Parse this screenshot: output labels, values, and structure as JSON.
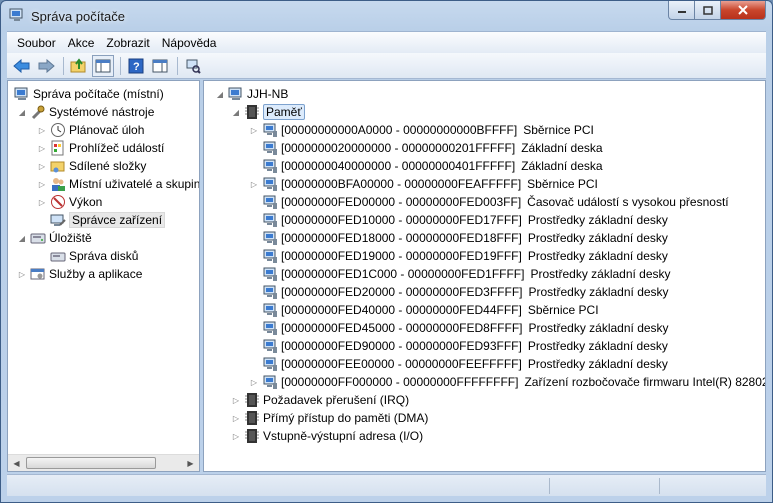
{
  "window": {
    "title": "Správa počítače"
  },
  "menu": [
    {
      "label": "Soubor"
    },
    {
      "label": "Akce"
    },
    {
      "label": "Zobrazit"
    },
    {
      "label": "Nápověda"
    }
  ],
  "toolbar": {
    "buttons": [
      "back-icon",
      "forward-icon",
      "up-folder-icon",
      "show-tree-icon",
      "help-icon",
      "action-pane-icon",
      "device-scan-icon"
    ]
  },
  "left_tree": [
    {
      "label": "Správa počítače (místní)",
      "icon": "computer-management-icon"
    },
    {
      "label": "Systémové nástroje",
      "icon": "tools-icon"
    },
    {
      "label": "Plánovač úloh",
      "icon": "clock-icon"
    },
    {
      "label": "Prohlížeč událostí",
      "icon": "event-viewer-icon"
    },
    {
      "label": "Sdílené složky",
      "icon": "shared-folder-icon"
    },
    {
      "label": "Místní uživatelé a skupiny",
      "icon": "users-icon"
    },
    {
      "label": "Výkon",
      "icon": "performance-icon"
    },
    {
      "label": "Správce zařízení",
      "icon": "device-manager-icon"
    },
    {
      "label": "Úložiště",
      "icon": "storage-icon"
    },
    {
      "label": "Správa disků",
      "icon": "disk-icon"
    },
    {
      "label": "Služby a aplikace",
      "icon": "services-icon"
    }
  ],
  "right_tree": {
    "root": "JJH-NB",
    "category_memory": "Paměť",
    "memory_items": [
      {
        "range": "[00000000000A0000 - 00000000000BFFFF]",
        "device": "Sběrnice PCI",
        "expandable": true
      },
      {
        "range": "[0000000020000000 - 00000000201FFFFF]",
        "device": "Základní deska",
        "expandable": false
      },
      {
        "range": "[0000000040000000 - 00000000401FFFFF]",
        "device": "Základní deska",
        "expandable": false
      },
      {
        "range": "[00000000BFA00000 - 00000000FEAFFFFF]",
        "device": "Sběrnice PCI",
        "expandable": true
      },
      {
        "range": "[00000000FED00000 - 00000000FED003FF]",
        "device": "Časovač událostí s vysokou přesností",
        "expandable": false
      },
      {
        "range": "[00000000FED10000 - 00000000FED17FFF]",
        "device": "Prostředky základní desky",
        "expandable": false
      },
      {
        "range": "[00000000FED18000 - 00000000FED18FFF]",
        "device": "Prostředky základní desky",
        "expandable": false
      },
      {
        "range": "[00000000FED19000 - 00000000FED19FFF]",
        "device": "Prostředky základní desky",
        "expandable": false
      },
      {
        "range": "[00000000FED1C000 - 00000000FED1FFFF]",
        "device": "Prostředky základní desky",
        "expandable": false
      },
      {
        "range": "[00000000FED20000 - 00000000FED3FFFF]",
        "device": "Prostředky základní desky",
        "expandable": false
      },
      {
        "range": "[00000000FED40000 - 00000000FED44FFF]",
        "device": "Sběrnice PCI",
        "expandable": false
      },
      {
        "range": "[00000000FED45000 - 00000000FED8FFFF]",
        "device": "Prostředky základní desky",
        "expandable": false
      },
      {
        "range": "[00000000FED90000 - 00000000FED93FFF]",
        "device": "Prostředky základní desky",
        "expandable": false
      },
      {
        "range": "[00000000FEE00000 - 00000000FEEFFFFF]",
        "device": "Prostředky základní desky",
        "expandable": false
      },
      {
        "range": "[00000000FF000000 - 00000000FFFFFFFF]",
        "device": "Zařízení rozbočovače firmwaru Intel(R) 82802",
        "expandable": true
      }
    ],
    "other_categories": [
      {
        "label": "Požadavek přerušení (IRQ)"
      },
      {
        "label": "Přímý přístup do paměti (DMA)"
      },
      {
        "label": "Vstupně-výstupní adresa (I/O)"
      }
    ]
  }
}
